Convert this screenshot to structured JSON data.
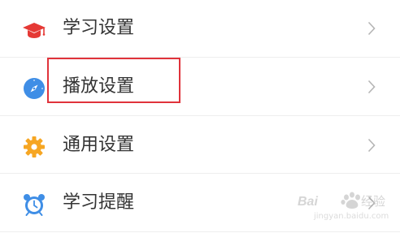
{
  "settings": {
    "items": [
      {
        "label": "学习设置",
        "icon": "graduation-cap-icon",
        "icon_color": "#e53935"
      },
      {
        "label": "播放设置",
        "icon": "compass-icon",
        "icon_color": "#3f8ee6"
      },
      {
        "label": "通用设置",
        "icon": "gear-icon",
        "icon_color": "#f6a623"
      },
      {
        "label": "学习提醒",
        "icon": "alarm-clock-icon",
        "icon_color": "#3f8ee6"
      }
    ]
  },
  "annotation": {
    "highlight_color": "#e0333b",
    "highlighted_item": "播放设置"
  },
  "watermark": {
    "text": "Baidu经验",
    "subtext": "jingyan.baidu.com"
  },
  "colors": {
    "text": "#333333",
    "divider": "#eeeeee",
    "chevron": "#b5b5b5",
    "background": "#ffffff"
  }
}
